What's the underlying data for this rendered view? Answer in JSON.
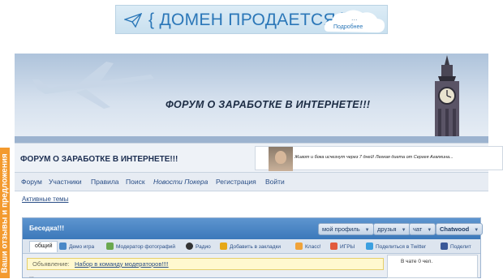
{
  "ad": {
    "text": "{ ДОМЕН ПРОДАЕТСЯ }",
    "button": "Подробнее",
    "dots": "...",
    "icons": [
      "paper-plane-icon",
      "cloud-icon"
    ]
  },
  "side_tab": {
    "label": "Ваши отзывы и предложения"
  },
  "banner": {
    "title": "ФОРУМ О ЗАРАБОТКЕ В ИНТЕРНЕТЕ!!!",
    "icons": [
      "airplane-icon",
      "big-ben-icon"
    ]
  },
  "header": {
    "title": "ФОРУМ О ЗАРАБОТКЕ В ИНТЕРНЕТЕ!!!",
    "ad_text": "Живот и бока исчезнут через 7 дней! Легкая диета от Сергея Агапкина..."
  },
  "nav": {
    "items": [
      "Форум",
      "Участники",
      "Правила",
      "Поиск",
      "Новости Покера",
      "Регистрация",
      "Войти"
    ]
  },
  "active_topics": "Активные темы",
  "panel": {
    "title": "Беседка!!!",
    "buttons": [
      "мой профиль",
      "друзья",
      "чат",
      "Chatwood"
    ],
    "tabs": [
      "общий",
      "Демо игра",
      "Модератор фотографий",
      "Радио",
      "Добавить в закладки",
      "Класс!",
      "ИГРЫ",
      "Поделиться в Twitter",
      "Поделит"
    ],
    "tab_colors": [
      "#ffffff",
      "#4a88c7",
      "#6aa84f",
      "#333333",
      "#e6a817",
      "#f0a33a",
      "#e25a3c",
      "#3ca0e0",
      "#3b5998"
    ],
    "announcement_label": "Объявление:",
    "announcement_link": "Набор в команду модераторов!!!!",
    "chat_status": "В чате 0 чел.",
    "partial_line": "..."
  },
  "colors": {
    "accent": "#3b78ba",
    "side_tab": "#f39a2e",
    "link": "#2a4e86"
  }
}
